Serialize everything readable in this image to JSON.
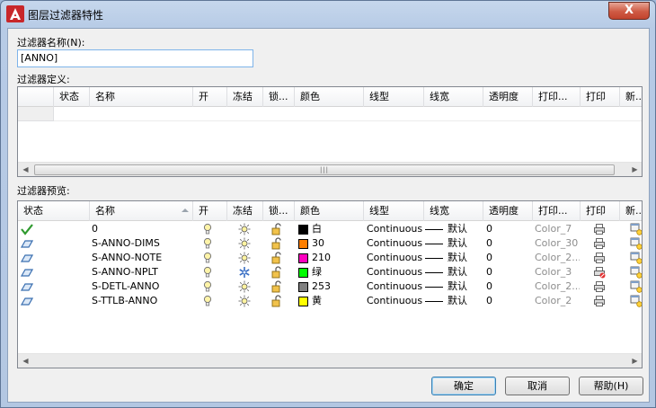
{
  "window": {
    "title": "图层过滤器特性",
    "close_label": "X"
  },
  "filter_name": {
    "label": "过滤器名称(N):",
    "value": "[ANNO]"
  },
  "definition": {
    "label": "过滤器定义:",
    "columns": [
      "状态",
      "名称",
      "开",
      "冻结",
      "锁...",
      "颜色",
      "线型",
      "线宽",
      "透明度",
      "打印...",
      "打印",
      "新..."
    ]
  },
  "preview": {
    "label": "过滤器预览:",
    "columns": [
      "状态",
      "名称",
      "开",
      "冻结",
      "锁...",
      "颜色",
      "线型",
      "线宽",
      "透明度",
      "打印...",
      "打印",
      "新..."
    ],
    "rows": [
      {
        "status": "current-check-icon",
        "name": "0",
        "on": "bulb-on-icon",
        "freeze": "sun-thaw-icon",
        "lock": "unlock-icon",
        "color_hex": "#000000",
        "color": "白",
        "linetype": "Continuous",
        "lineweight": "默认",
        "transparency": "0",
        "plot_style": "Color_7",
        "plot": "printer-icon",
        "new_vp": "new-vp-freeze-icon"
      },
      {
        "status": "layer-icon",
        "name": "S-ANNO-DIMS",
        "on": "bulb-on-icon",
        "freeze": "sun-thaw-icon",
        "lock": "unlock-icon",
        "color_hex": "#ff7f00",
        "color": "30",
        "linetype": "Continuous",
        "lineweight": "默认",
        "transparency": "0",
        "plot_style": "Color_30",
        "plot": "printer-icon",
        "new_vp": "new-vp-freeze-icon"
      },
      {
        "status": "layer-icon",
        "name": "S-ANNO-NOTE",
        "on": "bulb-on-icon",
        "freeze": "sun-thaw-icon",
        "lock": "unlock-icon",
        "color_hex": "#ff00bf",
        "color": "210",
        "linetype": "Continuous",
        "lineweight": "默认",
        "transparency": "0",
        "plot_style": "Color_2...",
        "plot": "printer-icon",
        "new_vp": "new-vp-freeze-icon"
      },
      {
        "status": "layer-icon",
        "name": "S-ANNO-NPLT",
        "on": "bulb-on-icon",
        "freeze": "snowflake-frozen-icon",
        "lock": "unlock-icon",
        "color_hex": "#00ff00",
        "color": "绿",
        "linetype": "Continuous",
        "lineweight": "默认",
        "transparency": "0",
        "plot_style": "Color_3",
        "plot": "no-plot-printer-icon",
        "new_vp": "new-vp-freeze-icon"
      },
      {
        "status": "layer-icon",
        "name": "S-DETL-ANNO",
        "on": "bulb-on-icon",
        "freeze": "sun-thaw-icon",
        "lock": "unlock-icon",
        "color_hex": "#808080",
        "color": "253",
        "linetype": "Continuous",
        "lineweight": "默认",
        "transparency": "0",
        "plot_style": "Color_2...",
        "plot": "printer-icon",
        "new_vp": "new-vp-freeze-icon"
      },
      {
        "status": "layer-icon",
        "name": "S-TTLB-ANNO",
        "on": "bulb-on-icon",
        "freeze": "sun-thaw-icon",
        "lock": "unlock-icon",
        "color_hex": "#ffff00",
        "color": "黄",
        "linetype": "Continuous",
        "lineweight": "默认",
        "transparency": "0",
        "plot_style": "Color_2",
        "plot": "printer-icon",
        "new_vp": "new-vp-freeze-icon"
      }
    ]
  },
  "buttons": {
    "ok": "确定",
    "cancel": "取消",
    "help": "帮助(H)"
  }
}
